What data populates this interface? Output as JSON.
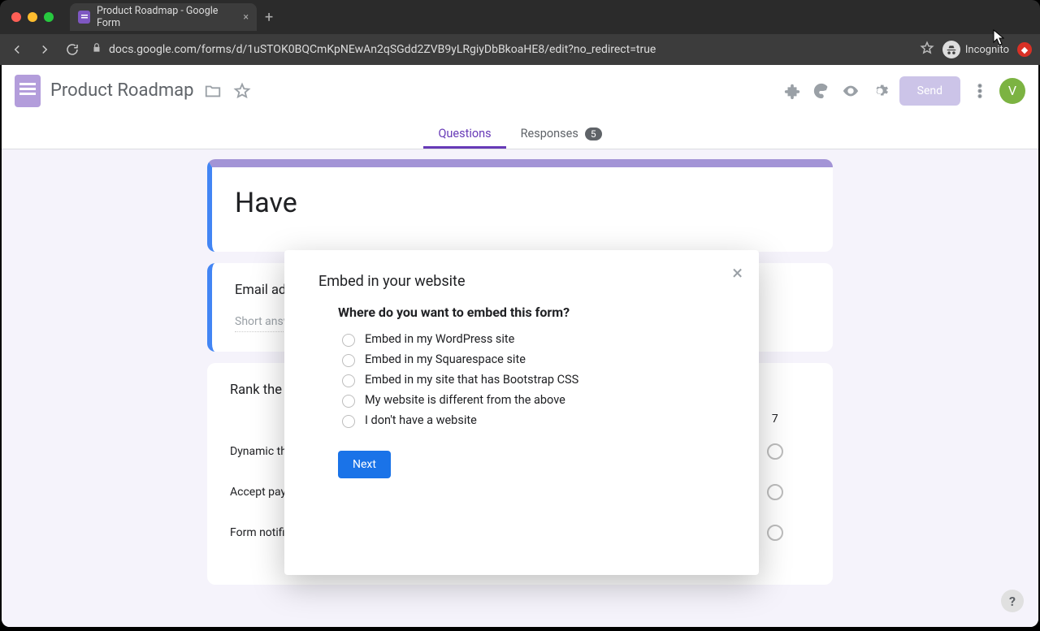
{
  "browser": {
    "tab_title": "Product Roadmap - Google Form",
    "url": "docs.google.com/forms/d/1uSTOK0BQCmKpNEwAn2qSGdd2ZVB9yLRgiyDbBkoaHE8/edit?no_redirect=true",
    "incognito_label": "Incognito"
  },
  "header": {
    "form_title": "Product Roadmap",
    "send_label": "Send",
    "avatar_initial": "V"
  },
  "tabs": {
    "questions": "Questions",
    "responses": "Responses",
    "responses_count": "5"
  },
  "form": {
    "heading_partial": "Have",
    "email_label_partial": "Email add",
    "short_answer_partial": "Short answ",
    "rank_label_partial": "Rank the",
    "grid_col_visible": "7",
    "grid_rows": [
      "Dynamic th…",
      "Accept pay…",
      "Form notifi…"
    ]
  },
  "modal": {
    "title": "Embed in your website",
    "question": "Where do you want to embed this form?",
    "options": [
      "Embed in my WordPress site",
      "Embed in my Squarespace site",
      "Embed in my site that has Bootstrap CSS",
      "My website is different from the above",
      "I don't have a website"
    ],
    "next_label": "Next"
  }
}
